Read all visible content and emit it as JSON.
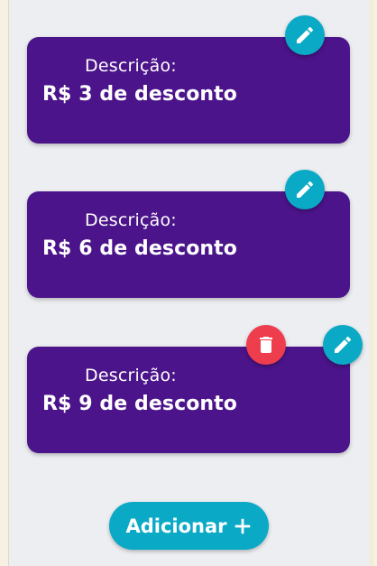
{
  "cards": [
    {
      "caption": "Descrição:",
      "text": "R$ 3 de desconto",
      "edit_icon": "pencil-icon"
    },
    {
      "caption": "Descrição:",
      "text": "R$ 6 de desconto",
      "edit_icon": "pencil-icon"
    },
    {
      "caption": "Descrição:",
      "text": "R$ 9 de desconto",
      "edit_icon": "pencil-icon",
      "delete_icon": "trash-icon"
    }
  ],
  "add_button": {
    "label": "Adicionar",
    "icon": "plus-icon"
  },
  "colors": {
    "card": "#4b148a",
    "edit_button": "#0aaac6",
    "delete_button": "#ee3d4d",
    "panel": "#eceef1",
    "page_background": "#f6f1e2"
  }
}
